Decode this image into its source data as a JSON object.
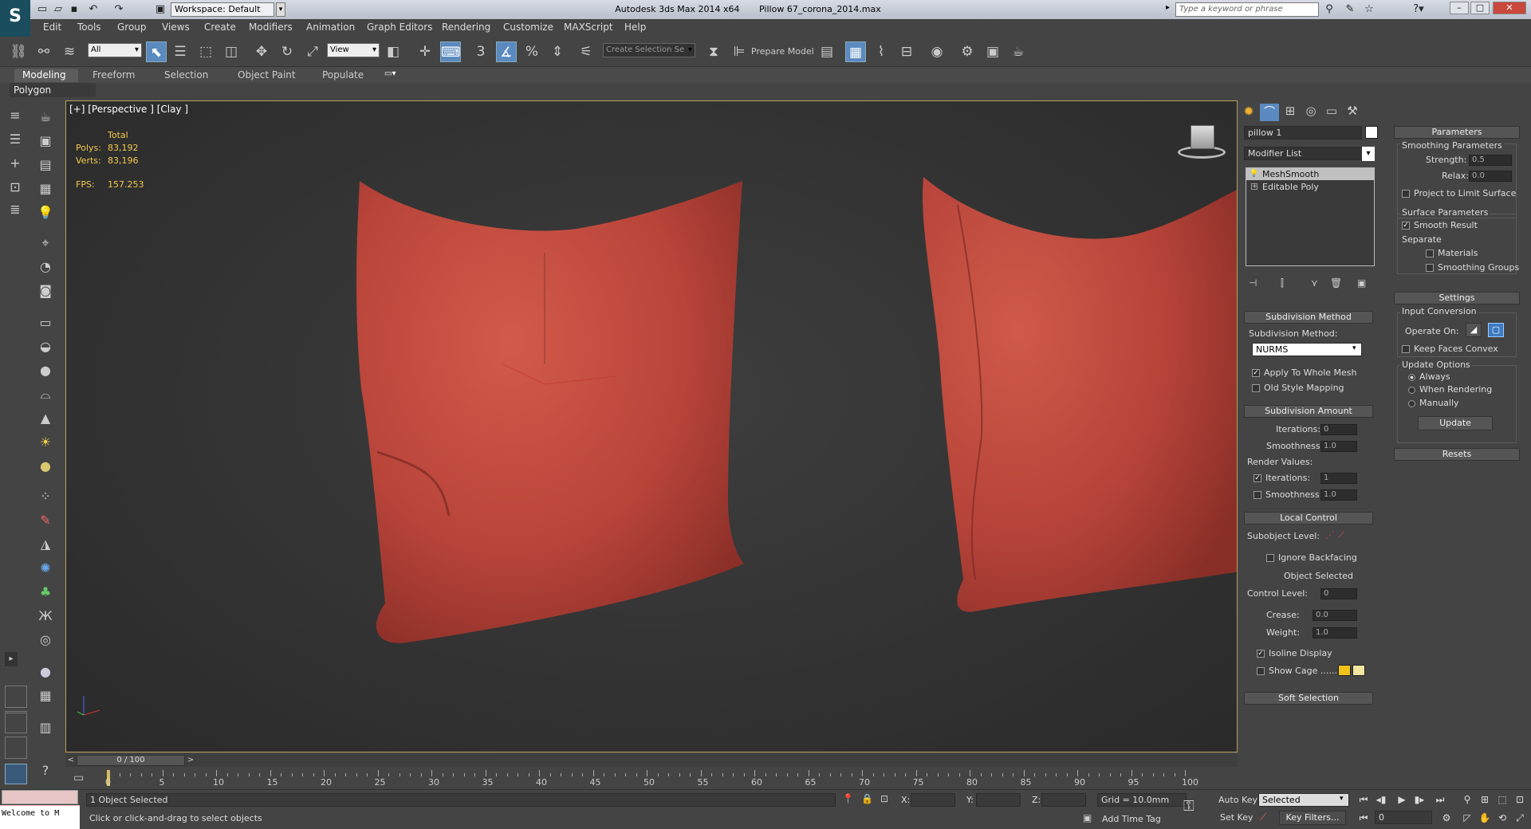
{
  "titlebar": {
    "workspace": "Workspace: Default",
    "app_title": "Autodesk 3ds Max  2014 x64",
    "file_title": "Pillow 67_corona_2014.max",
    "search_placeholder": "Type a keyword or phrase"
  },
  "menu": [
    "Edit",
    "Tools",
    "Group",
    "Views",
    "Create",
    "Modifiers",
    "Animation",
    "Graph Editors",
    "Rendering",
    "Customize",
    "MAXScript",
    "Help"
  ],
  "toolbar": {
    "filter": "All",
    "ref_coord": "View",
    "selection_set": "Create Selection Se",
    "prepare_model": "Prepare Model"
  },
  "ribbon": {
    "tabs": [
      "Modeling",
      "Freeform",
      "Selection",
      "Object Paint",
      "Populate"
    ],
    "active_tab": "Modeling",
    "panel": "Polygon Modeling"
  },
  "viewport": {
    "label": "[+] [Perspective ] [Clay ]",
    "stats": {
      "total_label": "Total",
      "polys_label": "Polys:",
      "polys": "83,192",
      "verts_label": "Verts:",
      "verts": "83,196",
      "fps_label": "FPS:",
      "fps": "157.253"
    }
  },
  "command_panel": {
    "object_name": "pillow 1",
    "modifier_list": "Modifier List",
    "stack": [
      "MeshSmooth",
      "Editable Poly"
    ],
    "subdivision_method": {
      "title": "Subdivision Method",
      "label": "Subdivision Method:",
      "method": "NURMS",
      "apply_whole": "Apply To Whole Mesh",
      "old_mapping": "Old Style Mapping"
    },
    "subdivision_amount": {
      "title": "Subdivision Amount",
      "iterations_label": "Iterations:",
      "iterations": "0",
      "smoothness_label": "Smoothness:",
      "smoothness": "1.0",
      "render_values": "Render Values:",
      "r_iterations_label": "Iterations:",
      "r_iterations": "1",
      "r_smoothness_label": "Smoothness:",
      "r_smoothness": "1.0"
    },
    "local_control": {
      "title": "Local Control",
      "subobject_label": "Subobject Level:",
      "ignore_backfacing": "Ignore Backfacing",
      "object_selected": "Object Selected",
      "control_level_label": "Control Level:",
      "control_level": "0",
      "crease_label": "Crease:",
      "crease": "0.0",
      "weight_label": "Weight:",
      "weight": "1.0",
      "isoline": "Isoline Display",
      "show_cage": "Show Cage ......"
    },
    "soft_selection": "Soft Selection",
    "parameters": {
      "title": "Parameters",
      "smoothing_params": "Smoothing Parameters",
      "strength_label": "Strength:",
      "strength": "0.5",
      "relax_label": "Relax:",
      "relax": "0.0",
      "project": "Project to Limit Surface",
      "surface_params": "Surface Parameters",
      "smooth_result": "Smooth Result",
      "separate": "Separate",
      "materials": "Materials",
      "smoothing_groups": "Smoothing Groups"
    },
    "settings": {
      "title": "Settings",
      "input_conversion": "Input Conversion",
      "operate_on": "Operate On:",
      "keep_convex": "Keep Faces Convex",
      "update_options": "Update Options",
      "always": "Always",
      "when_rendering": "When Rendering",
      "manually": "Manually",
      "update_btn": "Update"
    },
    "resets": "Resets"
  },
  "timeline": {
    "position": "0 / 100",
    "ticks": [
      "0",
      "5",
      "10",
      "15",
      "20",
      "25",
      "30",
      "35",
      "40",
      "45",
      "50",
      "55",
      "60",
      "65",
      "70",
      "75",
      "80",
      "85",
      "90",
      "95",
      "100"
    ]
  },
  "status": {
    "maxscript": "Welcome to M",
    "selected": "1 Object Selected",
    "prompt": "Click or click-and-drag to select objects",
    "x_label": "X:",
    "y_label": "Y:",
    "z_label": "Z:",
    "grid": "Grid = 10.0mm",
    "auto_key": "Auto Key",
    "set_key": "Set Key",
    "key_mode": "Selected",
    "key_filters": "Key Filters...",
    "add_time_tag": "Add Time Tag",
    "frame": "0"
  },
  "colors": {
    "pillow": "#c64a3c",
    "cage1": "#f2c21a",
    "cage2": "#f2e6a0",
    "viewport_border": "#b8a060"
  }
}
